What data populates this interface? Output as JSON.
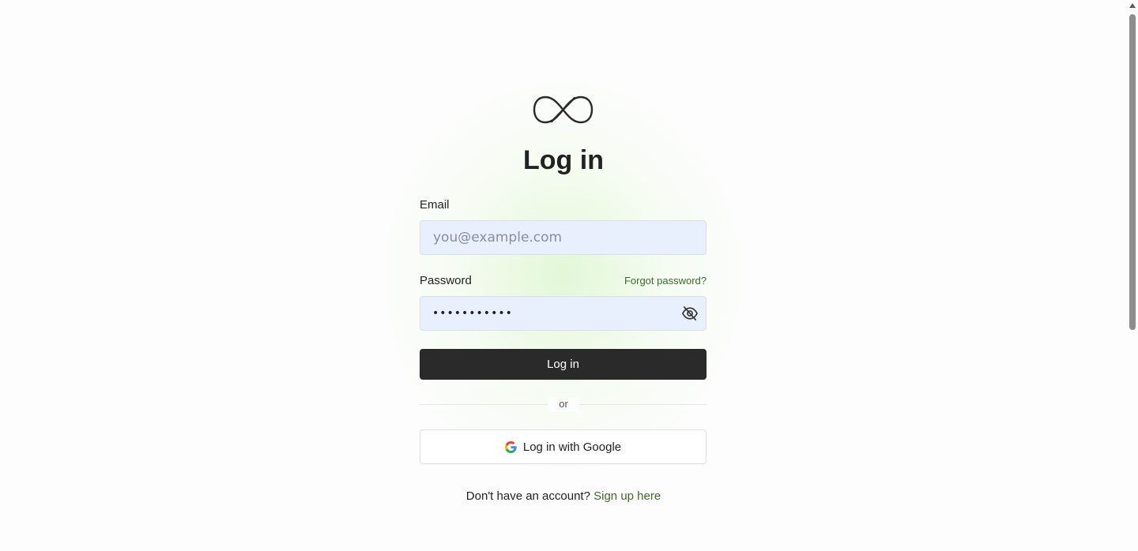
{
  "logo": {
    "icon": "infinity-icon"
  },
  "title": "Log in",
  "email": {
    "label": "Email",
    "value": "",
    "placeholder": "you@example.com"
  },
  "password": {
    "label": "Password",
    "value": "•••••••••••",
    "forgot_label": "Forgot password?",
    "toggle_icon": "eye-off-icon"
  },
  "login_button": {
    "label": "Log in"
  },
  "divider": {
    "label": "or"
  },
  "google_button": {
    "label": "Log in with Google",
    "icon": "google-icon"
  },
  "signup": {
    "prompt": "Don't have an account?",
    "link_label": "Sign up here"
  },
  "colors": {
    "accent_link": "#3d6b2a",
    "primary_button": "#2a2a2a",
    "input_background": "#e8f0fe"
  }
}
